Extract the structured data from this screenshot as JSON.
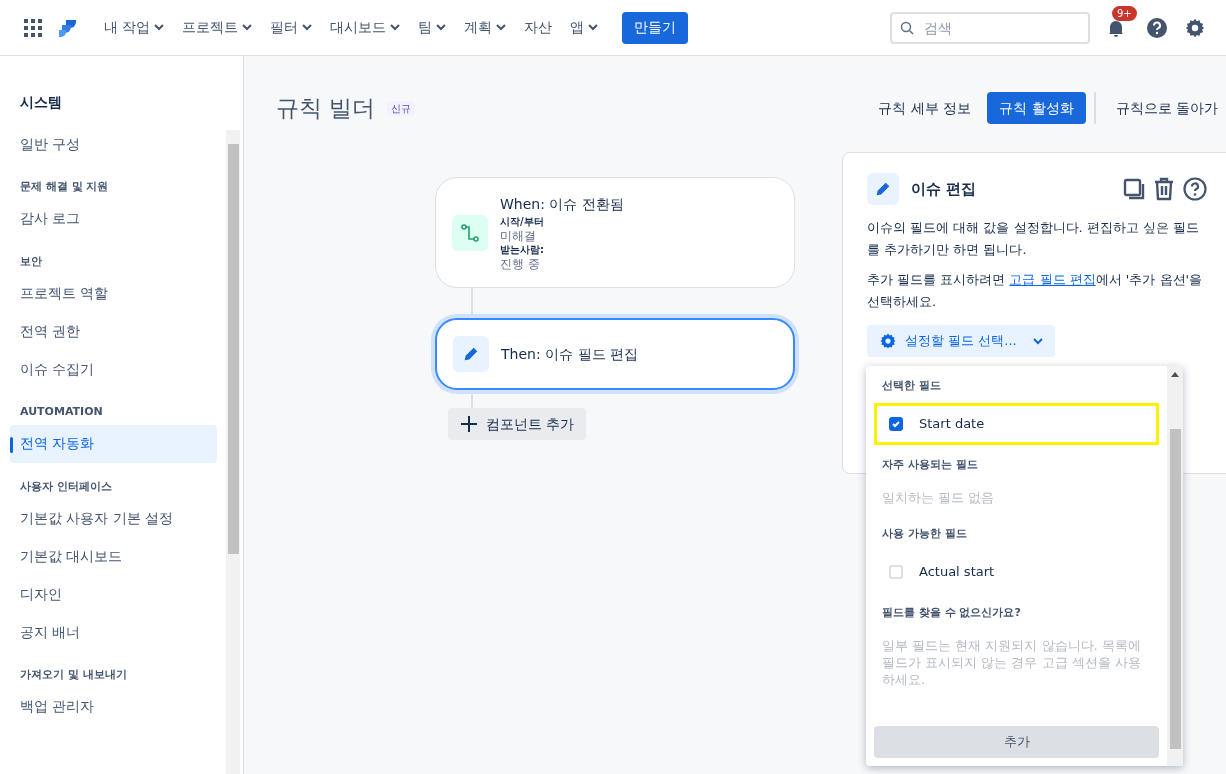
{
  "nav": {
    "items": [
      {
        "label": "내 작업",
        "has_menu": true
      },
      {
        "label": "프로젝트",
        "has_menu": true
      },
      {
        "label": "필터",
        "has_menu": true
      },
      {
        "label": "대시보드",
        "has_menu": true
      },
      {
        "label": "팀",
        "has_menu": true
      },
      {
        "label": "계획",
        "has_menu": true
      },
      {
        "label": "자산",
        "has_menu": false
      },
      {
        "label": "앱",
        "has_menu": true
      }
    ],
    "create_button": "만들기",
    "search": {
      "placeholder": "검색"
    },
    "notification_badge": "9+"
  },
  "sidebar": {
    "title": "시스템",
    "sections": [
      {
        "items": [
          {
            "label": "일반 구성",
            "selected": false
          }
        ]
      },
      {
        "heading": "문제 해결 및 지원",
        "items": [
          {
            "label": "감사 로그",
            "selected": false
          }
        ]
      },
      {
        "heading": "보안",
        "items": [
          {
            "label": "프로젝트 역할",
            "selected": false
          },
          {
            "label": "전역 권한",
            "selected": false
          },
          {
            "label": "이슈 수집기",
            "selected": false
          }
        ]
      },
      {
        "heading": "AUTOMATION",
        "items": [
          {
            "label": "전역 자동화",
            "selected": true
          }
        ]
      },
      {
        "heading": "사용자 인터페이스",
        "items": [
          {
            "label": "기본값 사용자 기본 설정",
            "selected": false
          },
          {
            "label": "기본값 대시보드",
            "selected": false
          },
          {
            "label": "디자인",
            "selected": false
          },
          {
            "label": "공지 배너",
            "selected": false
          }
        ]
      },
      {
        "heading": "가져오기 및 내보내기",
        "items": [
          {
            "label": "백업 관리자",
            "selected": false
          }
        ]
      }
    ]
  },
  "page": {
    "title": "규칙 빌더",
    "badge": "신규",
    "actions": [
      {
        "label": "규칙 세부 정보",
        "kind": "subtle"
      },
      {
        "label": "규칙 활성화",
        "kind": "primary"
      },
      {
        "label": "규칙으로 돌아가",
        "kind": "subtle"
      }
    ]
  },
  "flow": {
    "steps": [
      {
        "kind": "trigger",
        "title": "When: 이슈 전환됨",
        "selected": false,
        "details": [
          {
            "label": "시작/부터",
            "value": "미해결"
          },
          {
            "label": "받는사람:",
            "value": "진행 중"
          }
        ]
      },
      {
        "kind": "action",
        "title": "Then: 이슈 필드 편집",
        "selected": true
      }
    ],
    "add_button": "컴포넌트 추가"
  },
  "panel": {
    "title": "이슈 편집",
    "description": "이슈의 필드에 대해 값을 설정합니다. 편집하고 싶은 필드를 추가하기만 하면 됩니다.",
    "hint_before": "추가 필드를 표시하려면 ",
    "hint_link": "고급 필드 편집",
    "hint_after": "에서 '추가 옵션'을 선택하세요.",
    "field_select": "설정할 필드 선택...",
    "dropdown": {
      "sections": [
        {
          "heading": "선택한 필드",
          "fields": [
            {
              "label": "Start date",
              "checked": true,
              "highlighted": true
            }
          ]
        },
        {
          "heading": "자주 사용되는 필드",
          "empty": "일치하는 필드 없음"
        },
        {
          "heading": "사용 가능한 필드",
          "fields": [
            {
              "label": "Actual start",
              "checked": false,
              "highlighted": false
            }
          ]
        },
        {
          "heading": "필드를 찾을 수 없으신가요?",
          "empty": "일부 필드는 현재 지원되지 않습니다. 목록에 필드가 표시되지 않는 경우 고급 섹션을 사용하세요."
        }
      ],
      "add_button": "추가"
    }
  }
}
